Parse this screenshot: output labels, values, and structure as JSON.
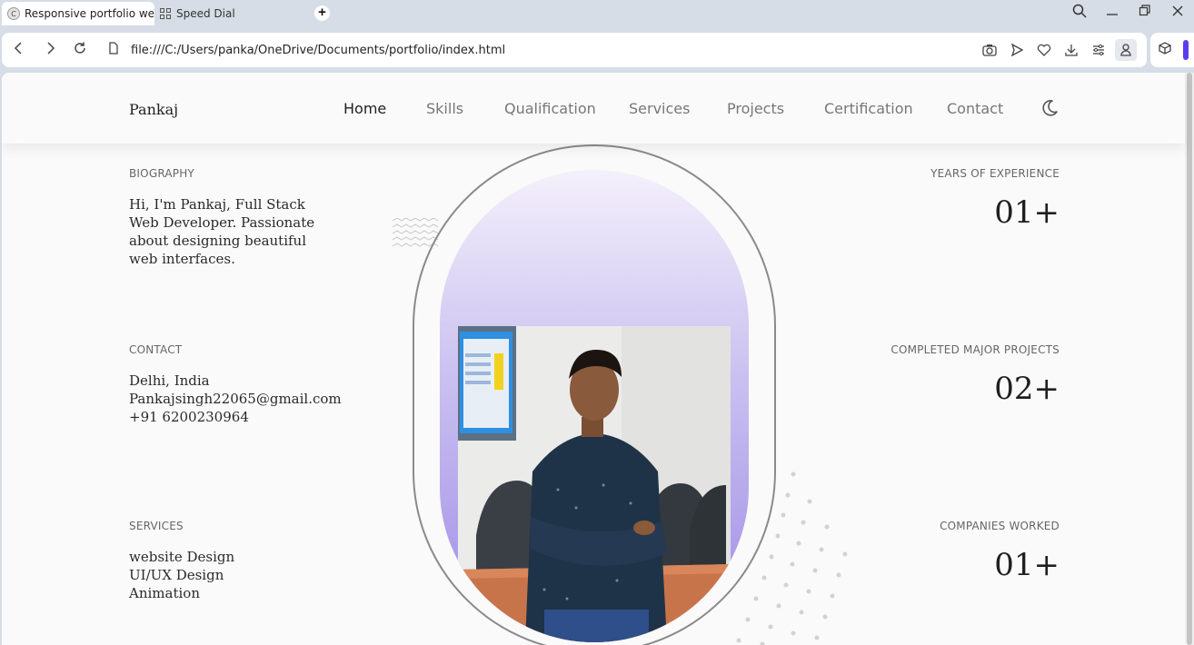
{
  "browser": {
    "tabs": [
      {
        "label": "Responsive portfolio webs",
        "active": true,
        "favicon": "C"
      },
      {
        "label": "Speed Dial",
        "active": false
      }
    ],
    "url": "file:///C:/Users/panka/OneDrive/Documents/portfolio/index.html",
    "accent_color": "#5b3cf0"
  },
  "site": {
    "logo": "Pankaj",
    "nav": [
      "Home",
      "Skills",
      "Qualification",
      "Services",
      "Projects",
      "Certification",
      "Contact"
    ],
    "active_nav": "Home",
    "theme_toggle_icon": "moon-icon"
  },
  "biography": {
    "label": "BIOGRAPHY",
    "text": "Hi, I'm Pankaj, Full Stack Web Developer. Passionate about designing beautiful web interfaces."
  },
  "contact": {
    "label": "CONTACT",
    "lines": [
      "Delhi, India",
      "Pankajsingh22065@gmail.com",
      "+91 6200230964"
    ]
  },
  "services": {
    "label": "SERVICES",
    "lines": [
      "website Design",
      "UI/UX Design",
      "Animation"
    ]
  },
  "stats": [
    {
      "label": "YEARS OF EXPERIENCE",
      "value": "01+"
    },
    {
      "label": "COMPLETED MAJOR PROJECTS",
      "value": "02+"
    },
    {
      "label": "COMPANIES WORKED",
      "value": "01+"
    }
  ]
}
